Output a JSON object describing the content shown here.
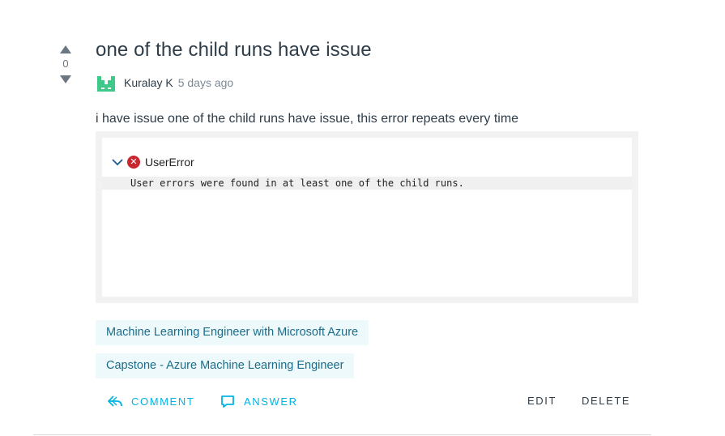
{
  "post": {
    "title": "one of the child runs have issue",
    "vote_count": "0",
    "author": "Kuralay K",
    "time": "5 days ago",
    "body": "i have issue one of the child runs have issue, this error repeats every time"
  },
  "screenshot": {
    "error_type": "UserError",
    "error_message": "User errors were found in at least one of the child runs."
  },
  "tags": [
    "Machine Learning Engineer with Microsoft Azure",
    "Capstone - Azure Machine Learning Engineer"
  ],
  "actions": {
    "comment": "COMMENT",
    "answer": "ANSWER",
    "edit": "EDIT",
    "delete": "DELETE"
  },
  "colors": {
    "accent": "#02b3e4",
    "tag_text": "#1b6c8a",
    "tag_bg": "#eef9fb",
    "error_red": "#c8272f"
  },
  "icons": [
    "vote-up-icon",
    "vote-down-icon",
    "avatar",
    "chevron-down-icon",
    "error-icon",
    "reply-icon",
    "answer-icon"
  ]
}
